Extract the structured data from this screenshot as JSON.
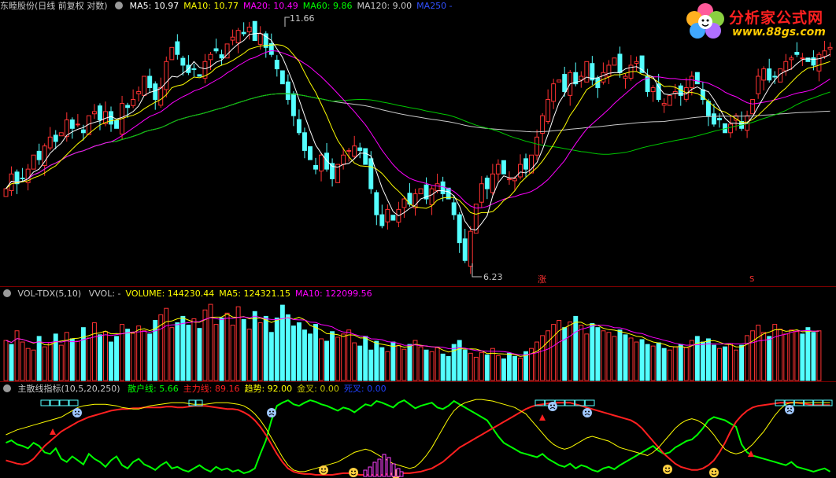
{
  "logo": {
    "brand": "分析家公式网",
    "url": "www.88gs.com"
  },
  "price_pane": {
    "title": "东睦股份(日线 前复权 对数)",
    "ma": [
      {
        "label": "MA5:",
        "value": "10.97",
        "color": "#ffffff"
      },
      {
        "label": "MA10:",
        "value": "10.77",
        "color": "#ffff00"
      },
      {
        "label": "MA20:",
        "value": "10.49",
        "color": "#ff00ff"
      },
      {
        "label": "MA60:",
        "value": "9.86",
        "color": "#00ff00"
      },
      {
        "label": "MA120:",
        "value": "9.00",
        "color": "#c8c8c8"
      },
      {
        "label": "MA250",
        "value": "-",
        "color": "#3050ff"
      }
    ],
    "high_label": "11.66",
    "low_label": "6.23",
    "marker_zhang": "涨",
    "marker_s": "S"
  },
  "volume_pane": {
    "title": "VOL-TDX(5,10)",
    "items": [
      {
        "label": "VVOL:",
        "value": "-",
        "color": "#c8c8c8"
      },
      {
        "label": "VOLUME:",
        "value": "144230.44",
        "color": "#ffff00"
      },
      {
        "label": "MA5:",
        "value": "124321.15",
        "color": "#ffff00"
      },
      {
        "label": "MA10:",
        "value": "122099.56",
        "color": "#ff00ff"
      }
    ]
  },
  "indicator_pane": {
    "title": "主散线指标(10,5,20,250)",
    "items": [
      {
        "label": "散户线:",
        "value": "5.66",
        "color": "#00ff00"
      },
      {
        "label": "主力线:",
        "value": "89.16",
        "color": "#ff2020"
      },
      {
        "label": "趋势:",
        "value": "92.00",
        "color": "#ffff00"
      },
      {
        "label": "金叉:",
        "value": "0.00",
        "color": "#c8c800"
      },
      {
        "label": "死叉:",
        "value": "0.00",
        "color": "#2040ff"
      }
    ]
  },
  "chart_data": [
    {
      "type": "candlestick",
      "title": "东睦股份(日线 前复权 对数)",
      "y_range": [
        6.0,
        12.0
      ],
      "grid": false,
      "annotations": [
        {
          "text": "11.66",
          "kind": "high"
        },
        {
          "text": "6.23",
          "kind": "low"
        }
      ],
      "close": [
        7.6,
        7.9,
        7.7,
        7.8,
        8.0,
        8.3,
        8.2,
        8.5,
        8.7,
        8.6,
        8.8,
        9.1,
        8.9,
        9.0,
        8.8,
        9.2,
        9.3,
        9.1,
        9.3,
        9.0,
        8.9,
        9.5,
        9.4,
        9.6,
        9.8,
        10.2,
        9.9,
        9.6,
        9.9,
        10.6,
        11.0,
        10.8,
        10.5,
        10.3,
        10.4,
        10.2,
        10.6,
        10.8,
        10.9,
        10.7,
        11.1,
        11.3,
        11.5,
        11.4,
        11.6,
        11.2,
        11.4,
        11.0,
        10.8,
        10.4,
        10.0,
        9.6,
        9.2,
        8.8,
        8.4,
        8.2,
        8.0,
        8.3,
        8.0,
        7.8,
        8.1,
        8.3,
        8.4,
        8.5,
        8.4,
        8.1,
        7.6,
        7.1,
        6.9,
        7.2,
        7.0,
        7.2,
        7.4,
        7.3,
        7.5,
        7.6,
        7.4,
        7.6,
        7.7,
        7.5,
        7.4,
        7.1,
        6.6,
        6.3,
        6.8,
        7.3,
        7.7,
        7.6,
        7.9,
        8.1,
        7.9,
        7.8,
        7.8,
        8.1,
        8.0,
        8.3,
        8.7,
        9.2,
        9.6,
        10.0,
        10.1,
        9.8,
        10.3,
        10.0,
        10.2,
        10.6,
        10.1,
        9.9,
        10.3,
        10.5,
        10.7,
        10.3,
        10.2,
        10.5,
        10.6,
        10.3,
        9.8,
        9.9,
        9.6,
        9.5,
        9.7,
        9.8,
        9.7,
        9.9,
        10.2,
        10.0,
        9.6,
        9.2,
        9.0,
        9.1,
        8.8,
        9.0,
        9.2,
        8.9,
        9.2,
        9.6,
        10.2,
        10.4,
        10.1,
        10.2,
        10.4,
        10.6,
        10.7,
        10.8,
        10.7,
        10.6,
        10.5,
        10.8,
        10.9,
        11.0
      ],
      "ma5": [
        7.6,
        7.75,
        7.73,
        7.75,
        7.8,
        7.94,
        8.0,
        8.16,
        8.34,
        8.46,
        8.56,
        8.74,
        8.82,
        8.88,
        8.92,
        9.0,
        9.04,
        9.08,
        9.14,
        9.18,
        9.12,
        9.16,
        9.22,
        9.3,
        9.44,
        9.7,
        9.78,
        9.82,
        9.88,
        10.04,
        10.2,
        10.18,
        10.28,
        10.4,
        10.6,
        10.44,
        10.4,
        10.46,
        10.58,
        10.64,
        10.8,
        10.96,
        11.1,
        11.2,
        11.38,
        11.4,
        11.42,
        11.32,
        11.2,
        10.96,
        10.72,
        10.36,
        10.0,
        9.6,
        9.2,
        8.84,
        8.52,
        8.34,
        8.18,
        8.06,
        8.04,
        8.1,
        8.12,
        8.22,
        8.34,
        8.34,
        8.28,
        7.94,
        7.62,
        7.38,
        7.16,
        7.08,
        7.14,
        7.22,
        7.28,
        7.4,
        7.44,
        7.48,
        7.56,
        7.56,
        7.54,
        7.46,
        7.26,
        6.98,
        6.84,
        6.82,
        6.94,
        7.08,
        7.46,
        7.72,
        7.86,
        7.82,
        7.82,
        7.94,
        7.92,
        8.0,
        8.14,
        8.42,
        8.76,
        9.16,
        9.52,
        9.74,
        10.0,
        10.04,
        10.08,
        10.18,
        10.14,
        10.16,
        10.22,
        10.28,
        10.3,
        10.3,
        10.4,
        10.44,
        10.46,
        10.38,
        10.24,
        10.18,
        9.92,
        9.74,
        9.72,
        9.76,
        9.74,
        9.74,
        9.86,
        9.92,
        9.84,
        9.8,
        9.6,
        9.38,
        9.14,
        9.02,
        9.02,
        9.0,
        9.02,
        9.18,
        9.42,
        9.66,
        9.9,
        10.1,
        10.26,
        10.34,
        10.4,
        10.54,
        10.66,
        10.68,
        10.66,
        10.68,
        10.72,
        10.8
      ],
      "ma10": [
        7.6,
        7.7,
        7.72,
        7.74,
        7.76,
        7.82,
        7.86,
        7.92,
        8.0,
        8.07,
        8.19,
        8.31,
        8.43,
        8.55,
        8.65,
        8.78,
        8.88,
        8.98,
        9.04,
        9.08,
        9.1,
        9.13,
        9.18,
        9.21,
        9.27,
        9.37,
        9.45,
        9.53,
        9.6,
        9.72,
        9.9,
        9.95,
        9.98,
        10.08,
        10.18,
        10.16,
        10.21,
        10.29,
        10.43,
        10.5,
        10.55,
        10.63,
        10.73,
        10.83,
        10.95,
        11.0,
        11.04,
        11.06,
        11.07,
        11.08,
        11.06,
        10.97,
        10.79,
        10.6,
        10.3,
        10.02,
        9.78,
        9.49,
        9.2,
        8.89,
        8.62,
        8.44,
        8.26,
        8.13,
        8.07,
        8.06,
        8.05,
        8.0,
        7.91,
        7.78,
        7.65,
        7.55,
        7.44,
        7.3,
        7.25,
        7.23,
        7.22,
        7.27,
        7.38,
        7.42,
        7.43,
        7.43,
        7.37,
        7.26,
        7.14,
        7.11,
        7.14,
        7.14,
        7.16,
        7.25,
        7.37,
        7.44,
        7.56,
        7.72,
        7.83,
        7.93,
        8.03,
        8.17,
        8.34,
        8.53,
        8.76,
        8.95,
        9.21,
        9.4,
        9.62,
        9.85,
        9.94,
        10.05,
        10.12,
        10.18,
        10.24,
        10.24,
        10.28,
        10.32,
        10.33,
        10.25,
        10.21,
        10.14,
        10.04,
        9.93,
        9.94,
        9.91,
        9.84,
        9.77,
        9.78,
        9.75,
        9.67,
        9.55,
        9.43,
        9.33,
        9.29,
        9.21,
        9.13,
        9.04,
        9.05,
        9.11,
        9.21,
        9.34,
        9.47,
        9.61,
        9.77,
        9.89,
        10.04,
        10.19,
        10.32,
        10.42,
        10.45,
        10.5,
        10.55,
        10.6
      ]
    },
    {
      "type": "bar",
      "title": "VOL-TDX(5,10)",
      "series_note": "volume bars, rising days hollow red, falling days solid cyan",
      "values": [
        50,
        45,
        62,
        48,
        40,
        38,
        55,
        42,
        47,
        58,
        44,
        60,
        52,
        49,
        66,
        53,
        72,
        57,
        61,
        48,
        55,
        70,
        64,
        59,
        68,
        62,
        58,
        75,
        82,
        90,
        66,
        72,
        80,
        69,
        77,
        65,
        88,
        95,
        70,
        78,
        84,
        69,
        92,
        76,
        64,
        86,
        72,
        80,
        60,
        78,
        94,
        82,
        68,
        72,
        63,
        58,
        70,
        52,
        49,
        61,
        54,
        58,
        63,
        47,
        43,
        55,
        38,
        49,
        41,
        36,
        48,
        44,
        39,
        45,
        50,
        42,
        38,
        36,
        41,
        33,
        30,
        45,
        50,
        38,
        34,
        29,
        35,
        32,
        40,
        31,
        27,
        34,
        30,
        28,
        36,
        40,
        48,
        56,
        62,
        70,
        75,
        66,
        73,
        80,
        69,
        58,
        71,
        66,
        62,
        60,
        55,
        63,
        57,
        53,
        48,
        51,
        45,
        43,
        47,
        40,
        38,
        42,
        45,
        41,
        50,
        55,
        48,
        52,
        44,
        40,
        42,
        46,
        38,
        44,
        56,
        62,
        69,
        60,
        55,
        70,
        64,
        58,
        63,
        61,
        58,
        66,
        60,
        62
      ],
      "up": [
        1,
        0,
        1,
        1,
        1,
        1,
        0,
        1,
        1,
        0,
        1,
        1,
        0,
        1,
        0,
        1,
        1,
        0,
        1,
        0,
        0,
        1,
        0,
        1,
        1,
        1,
        0,
        0,
        1,
        1,
        1,
        0,
        0,
        0,
        1,
        0,
        1,
        1,
        1,
        0,
        1,
        1,
        1,
        0,
        1,
        0,
        1,
        0,
        0,
        0,
        0,
        0,
        0,
        0,
        0,
        0,
        0,
        1,
        0,
        0,
        1,
        1,
        1,
        1,
        0,
        0,
        0,
        0,
        0,
        1,
        0,
        1,
        1,
        0,
        1,
        1,
        0,
        1,
        1,
        0,
        0,
        0,
        0,
        0,
        1,
        1,
        1,
        0,
        1,
        1,
        0,
        0,
        0,
        1,
        0,
        1,
        1,
        1,
        1,
        1,
        1,
        0,
        1,
        0,
        1,
        1,
        0,
        0,
        1,
        1,
        1,
        0,
        0,
        1,
        1,
        0,
        0,
        1,
        0,
        0,
        1,
        1,
        0,
        1,
        1,
        0,
        0,
        0,
        0,
        1,
        0,
        1,
        1,
        0,
        1,
        1,
        1,
        1,
        0,
        1,
        1,
        1,
        1,
        1,
        0,
        0,
        0,
        1,
        1,
        1
      ],
      "ma5_volume": [
        null
      ]
    },
    {
      "type": "line",
      "title": "主散线指标(10,5,20,250)",
      "y_range": [
        0,
        100
      ],
      "series": [
        {
          "name": "散户线",
          "color": "#00ff00",
          "values": [
            42,
            45,
            40,
            38,
            35,
            42,
            38,
            30,
            28,
            35,
            22,
            18,
            25,
            20,
            15,
            28,
            22,
            18,
            12,
            20,
            25,
            14,
            10,
            18,
            22,
            15,
            12,
            8,
            14,
            18,
            10,
            12,
            8,
            6,
            10,
            14,
            9,
            6,
            12,
            8,
            10,
            6,
            8,
            4,
            6,
            10,
            28,
            45,
            70,
            88,
            92,
            95,
            90,
            88,
            92,
            95,
            93,
            90,
            88,
            85,
            82,
            86,
            84,
            80,
            85,
            90,
            88,
            94,
            92,
            89,
            86,
            92,
            95,
            90,
            85,
            88,
            90,
            92,
            86,
            84,
            88,
            94,
            90,
            86,
            82,
            78,
            74,
            70,
            60,
            50,
            42,
            38,
            34,
            30,
            28,
            26,
            24,
            28,
            22,
            18,
            14,
            12,
            16,
            10,
            14,
            12,
            8,
            6,
            10,
            12,
            9,
            14,
            18,
            22,
            26,
            30,
            34,
            38,
            32,
            28,
            30,
            36,
            40,
            44,
            46,
            52,
            60,
            70,
            74,
            72,
            70,
            66,
            62,
            40,
            30,
            26,
            24,
            22,
            20,
            18,
            16,
            14,
            18,
            12,
            10,
            8,
            6,
            8,
            10,
            6
          ]
        },
        {
          "name": "主力线",
          "color": "#ff2020",
          "values": [
            20,
            18,
            16,
            15,
            17,
            22,
            30,
            38,
            44,
            50,
            56,
            60,
            64,
            68,
            71,
            74,
            76,
            78,
            80,
            82,
            83,
            84,
            84,
            85,
            85,
            86,
            86,
            86,
            86,
            87,
            87,
            86,
            86,
            87,
            88,
            88,
            88,
            87,
            86,
            85,
            84,
            84,
            83,
            80,
            76,
            70,
            62,
            52,
            40,
            28,
            18,
            10,
            6,
            4,
            3,
            3,
            2,
            2,
            2,
            2,
            3,
            4,
            4,
            3,
            2,
            2,
            2,
            2,
            2,
            3,
            3,
            4,
            4,
            4,
            5,
            6,
            8,
            10,
            14,
            18,
            24,
            30,
            36,
            40,
            44,
            48,
            52,
            56,
            60,
            64,
            68,
            72,
            76,
            80,
            84,
            87,
            89,
            90,
            91,
            92,
            92,
            92,
            92,
            90,
            88,
            86,
            84,
            82,
            80,
            78,
            76,
            74,
            72,
            70,
            66,
            60,
            52,
            44,
            36,
            28,
            22,
            16,
            12,
            10,
            8,
            8,
            10,
            14,
            20,
            30,
            42,
            56,
            68,
            76,
            82,
            86,
            88,
            89,
            90,
            91,
            92,
            92,
            92,
            92,
            91,
            90,
            89,
            89,
            89,
            89
          ]
        },
        {
          "name": "趋势",
          "color": "#ffff00",
          "values": [
            52,
            55,
            58,
            60,
            62,
            64,
            66,
            68,
            70,
            72,
            74,
            78,
            82,
            86,
            88,
            89,
            90,
            90,
            90,
            89,
            88,
            86,
            85,
            84,
            84,
            86,
            88,
            89,
            90,
            91,
            92,
            92,
            92,
            91,
            90,
            90,
            90,
            91,
            92,
            92,
            92,
            91,
            90,
            88,
            84,
            78,
            70,
            60,
            48,
            36,
            24,
            14,
            8,
            6,
            6,
            8,
            10,
            12,
            14,
            16,
            18,
            22,
            26,
            30,
            32,
            34,
            32,
            28,
            24,
            20,
            16,
            14,
            12,
            10,
            12,
            18,
            26,
            36,
            48,
            60,
            72,
            82,
            88,
            92,
            94,
            96,
            96,
            95,
            94,
            92,
            90,
            88,
            86,
            82,
            78,
            70,
            62,
            54,
            46,
            40,
            36,
            34,
            36,
            40,
            44,
            48,
            50,
            48,
            46,
            44,
            40,
            36,
            34,
            32,
            30,
            28,
            26,
            30,
            36,
            44,
            52,
            60,
            66,
            70,
            72,
            70,
            66,
            60,
            52,
            42,
            34,
            30,
            28,
            30,
            34,
            40,
            48,
            56,
            66,
            76,
            84,
            90,
            92,
            92,
            92,
            92,
            92,
            92,
            92,
            92
          ]
        }
      ]
    }
  ]
}
